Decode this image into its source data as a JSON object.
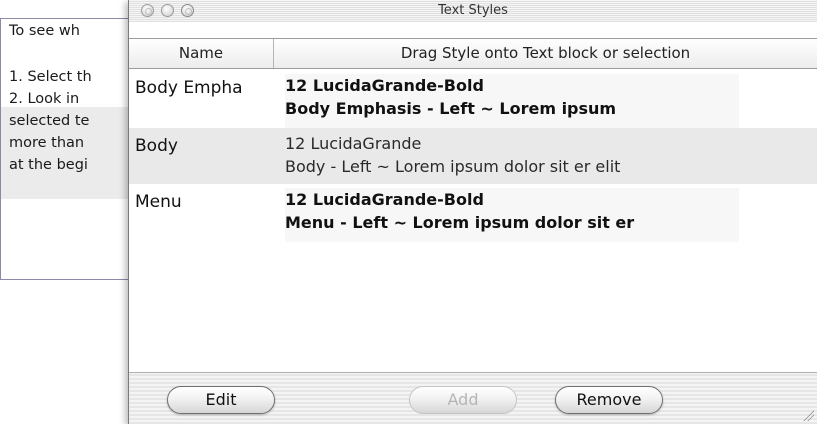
{
  "background_document": {
    "lines": [
      "To see wh",
      "",
      "1. Select th",
      "2. Look in",
      "selected te",
      "more than",
      "at the begi"
    ]
  },
  "window": {
    "title": "Text Styles",
    "table": {
      "headers": {
        "name": "Name",
        "drag": "Drag Style onto Text block or selection"
      },
      "rows": [
        {
          "name": "Body Empha",
          "preview_line1": "12 LucidaGrande-Bold",
          "preview_line2": "Body Emphasis - Left ~ Lorem ipsum"
        },
        {
          "name": "Body",
          "preview_line1": "12 LucidaGrande",
          "preview_line2": "Body - Left ~ Lorem ipsum dolor sit er elit"
        },
        {
          "name": "Menu",
          "preview_line1": "12 LucidaGrande-Bold",
          "preview_line2": "Menu - Left ~ Lorem ipsum dolor sit er"
        }
      ]
    },
    "buttons": {
      "edit": "Edit",
      "add": "Add",
      "remove": "Remove"
    }
  },
  "colors": {
    "selected_row": "#e9e9e9",
    "window_stripe": "#e6e6e6"
  }
}
